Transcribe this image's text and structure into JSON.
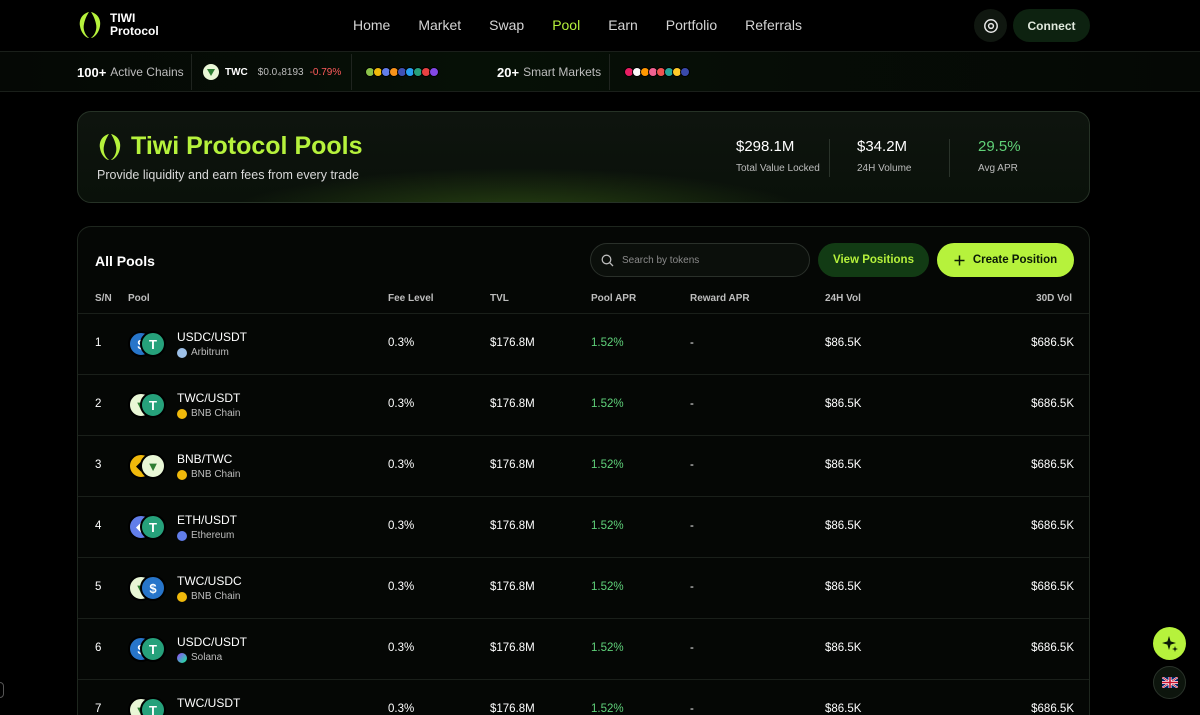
{
  "brand": {
    "line1": "TIWI",
    "line2": "Protocol"
  },
  "nav": {
    "items": [
      "Home",
      "Market",
      "Swap",
      "Pool",
      "Earn",
      "Portfolio",
      "Referrals"
    ],
    "active": "Pool",
    "connect_label": "Connect"
  },
  "ticker": {
    "chains_count": "100+",
    "chains_label": "Active Chains",
    "token_symbol": "TWC",
    "token_price": "$0.0₄8193",
    "token_change": "-0.79%",
    "markets_count": "20+",
    "markets_label": "Smart Markets"
  },
  "hero": {
    "title": "Tiwi Protocol Pools",
    "subtitle": "Provide liquidity and earn fees from every trade",
    "stats": [
      {
        "value": "$298.1M",
        "label": "Total Value Locked"
      },
      {
        "value": "$34.2M",
        "label": "24H Volume"
      },
      {
        "value": "29.5%",
        "label": "Avg APR"
      }
    ]
  },
  "pools": {
    "title": "All Pools",
    "search_placeholder": "Search by tokens",
    "view_label": "View Positions",
    "create_label": "Create Position",
    "columns": [
      "S/N",
      "Pool",
      "Fee Level",
      "TVL",
      "Pool APR",
      "Reward APR",
      "24H Vol",
      "30D Vol"
    ],
    "rows": [
      {
        "sn": "1",
        "pair": "USDC/USDT",
        "chain": "Arbitrum",
        "fee": "0.3%",
        "tvl": "$176.8M",
        "apr": "1.52%",
        "reward": "-",
        "vol24": "$86.5K",
        "vol30": "$686.5K"
      },
      {
        "sn": "2",
        "pair": "TWC/USDT",
        "chain": "BNB Chain",
        "fee": "0.3%",
        "tvl": "$176.8M",
        "apr": "1.52%",
        "reward": "-",
        "vol24": "$86.5K",
        "vol30": "$686.5K"
      },
      {
        "sn": "3",
        "pair": "BNB/TWC",
        "chain": "BNB Chain",
        "fee": "0.3%",
        "tvl": "$176.8M",
        "apr": "1.52%",
        "reward": "-",
        "vol24": "$86.5K",
        "vol30": "$686.5K"
      },
      {
        "sn": "4",
        "pair": "ETH/USDT",
        "chain": "Ethereum",
        "fee": "0.3%",
        "tvl": "$176.8M",
        "apr": "1.52%",
        "reward": "-",
        "vol24": "$86.5K",
        "vol30": "$686.5K"
      },
      {
        "sn": "5",
        "pair": "TWC/USDC",
        "chain": "BNB Chain",
        "fee": "0.3%",
        "tvl": "$176.8M",
        "apr": "1.52%",
        "reward": "-",
        "vol24": "$86.5K",
        "vol30": "$686.5K"
      },
      {
        "sn": "6",
        "pair": "USDC/USDT",
        "chain": "Solana",
        "fee": "0.3%",
        "tvl": "$176.8M",
        "apr": "1.52%",
        "reward": "-",
        "vol24": "$86.5K",
        "vol30": "$686.5K"
      },
      {
        "sn": "7",
        "pair": "TWC/USDT",
        "chain": "",
        "fee": "0.3%",
        "tvl": "$176.8M",
        "apr": "1.52%",
        "reward": "-",
        "vol24": "$86.5K",
        "vol30": "$686.5K"
      }
    ]
  },
  "colors": {
    "accent": "#b6f23c",
    "positive": "#5fd17a",
    "negative": "#ff5b5b"
  }
}
